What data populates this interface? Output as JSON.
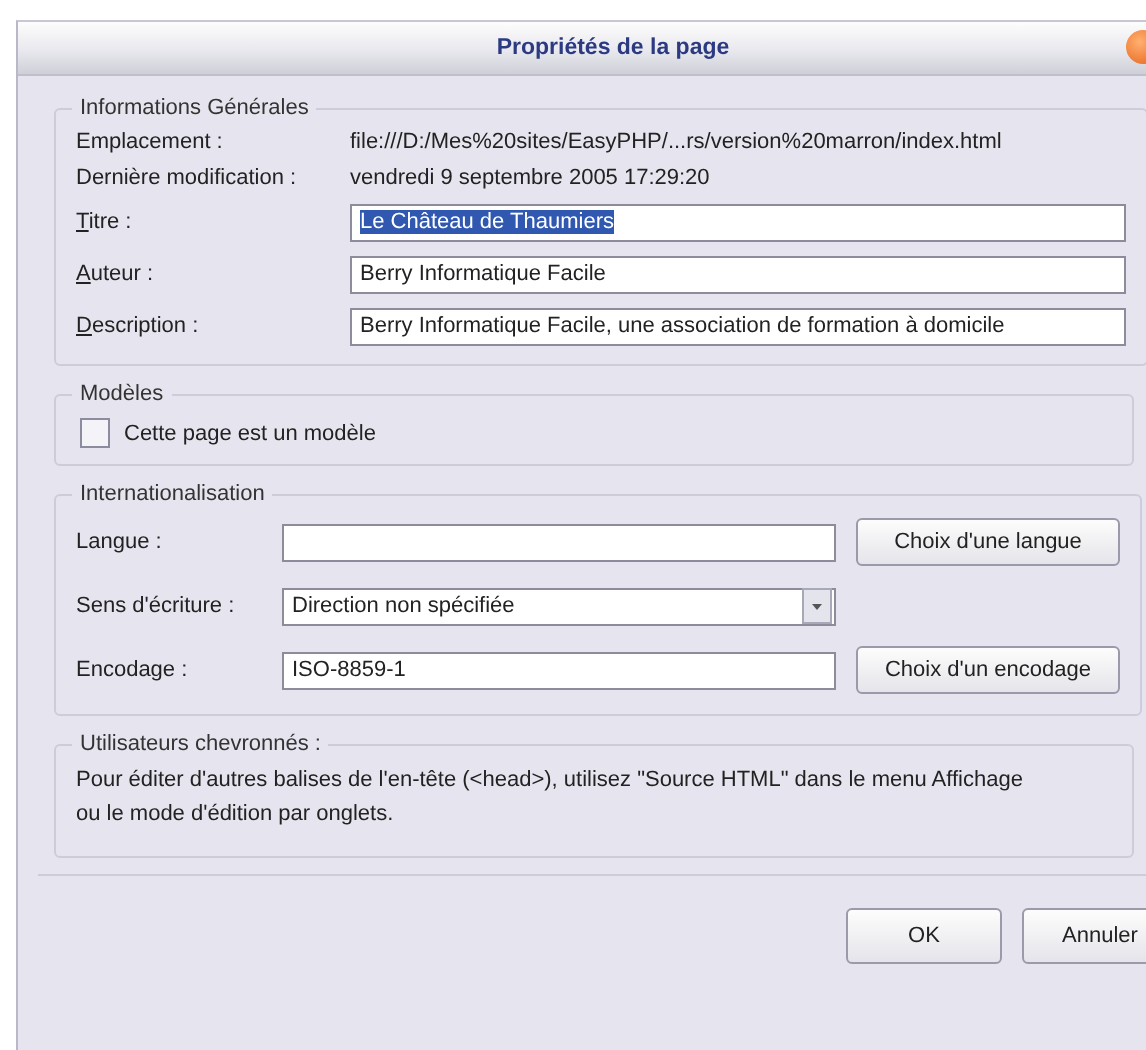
{
  "window": {
    "title": "Propriétés de la page"
  },
  "general": {
    "legend": "Informations Générales",
    "info": [
      {
        "label": "Emplacement :",
        "value": "file:///D:/Mes%20sites/EasyPHP/...rs/version%20marron/index.html"
      },
      {
        "label": "Dernière modification :",
        "value": "vendredi 9 septembre 2005 17:29:20"
      }
    ],
    "fields": [
      {
        "label": "Titre :",
        "value": "Le Château de Thaumiers",
        "selected": true
      },
      {
        "label": "Auteur :",
        "value": "Berry Informatique Facile",
        "selected": false
      },
      {
        "label": "Description :",
        "value": "Berry Informatique Facile, une association de formation à domicile",
        "selected": false
      }
    ]
  },
  "templates": {
    "legend": "Modèles",
    "checkbox": {
      "label": "Cette page est un modèle",
      "checked": false
    }
  },
  "intl": {
    "legend": "Internationalisation",
    "rows": [
      {
        "kind": "text",
        "label": "Langue :",
        "button": "Choix d'une langue"
      },
      {
        "kind": "select",
        "label": "Sens d'écriture :",
        "value": "Direction non spécifiée"
      },
      {
        "kind": "text",
        "label": "Encodage :",
        "value": "ISO-8859-1",
        "button": "Choix d'un encodage"
      }
    ]
  },
  "advanced": {
    "legend": "Utilisateurs chevronnés :",
    "text": "Pour éditer d'autres balises de l'en-tête (<head>), utilisez \"Source HTML\" dans le menu Affichage ou le mode d'édition par onglets."
  },
  "buttons": [
    "OK",
    "Annuler"
  ]
}
